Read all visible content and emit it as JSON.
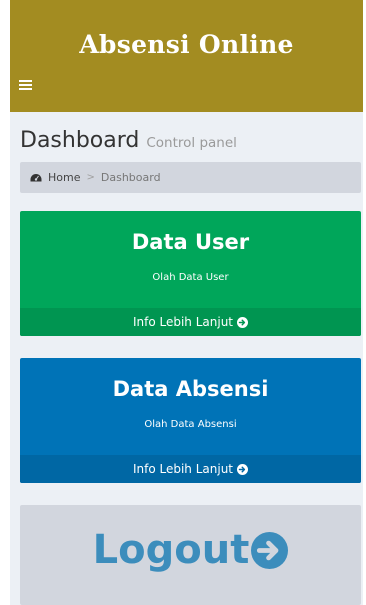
{
  "app": {
    "title": "Absensi Online"
  },
  "page": {
    "title": "Dashboard",
    "subtitle": "Control panel"
  },
  "breadcrumb": {
    "home": "Home",
    "separator": ">",
    "current": "Dashboard"
  },
  "boxes": [
    {
      "title": "Data User",
      "description": "Olah Data User",
      "link": "Info Lebih Lanjut",
      "color": "#00a65a"
    },
    {
      "title": "Data Absensi",
      "description": "Olah Data Absensi",
      "link": "Info Lebih Lanjut",
      "color": "#0073b7"
    }
  ],
  "logout": {
    "label": "Logout",
    "icon": "circle-arrow-right-icon"
  },
  "colors": {
    "header": "#a38c21",
    "background": "#ecf0f5",
    "breadcrumb": "#d2d6de",
    "logout_text": "#3c8dbc"
  }
}
